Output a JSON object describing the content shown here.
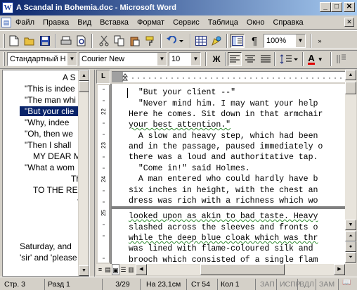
{
  "window": {
    "title": "A Scandal in Bohemia.doc - Microsoft Word",
    "app_icon": "W",
    "minimize": "_",
    "maximize": "□",
    "close": "✕"
  },
  "menu": {
    "items": [
      "Файл",
      "Правка",
      "Вид",
      "Вставка",
      "Формат",
      "Сервис",
      "Таблица",
      "Окно",
      "Справка"
    ]
  },
  "standard_toolbar": {
    "zoom": "100%"
  },
  "format_toolbar": {
    "style": "Стандартный Н",
    "font": "Courier New",
    "size": "10",
    "bold": "Ж",
    "font_color_letter": "A",
    "font_color": "#e00000"
  },
  "document_map": {
    "items": [
      {
        "text": "A S",
        "selected": false
      },
      {
        "text": "\"This is indee",
        "selected": false
      },
      {
        "text": "\"The man whi",
        "selected": false
      },
      {
        "text": "\"But your clie",
        "selected": true
      },
      {
        "text": "\"Why, indee",
        "selected": false
      },
      {
        "text": "\"Oh, then we",
        "selected": false
      },
      {
        "text": "\"Then I shall",
        "selected": false
      },
      {
        "text": "MY DEAR M",
        "selected": false
      },
      {
        "text": "\"What a wom",
        "selected": false
      },
      {
        "text": "Th",
        "selected": false
      },
      {
        "text": "TO THE RE",
        "selected": false
      },
      {
        "text": "Saturday, and",
        "selected": false
      },
      {
        "text": "'sir' and 'please",
        "selected": false
      }
    ]
  },
  "ruler": {
    "corner": "L",
    "vertical_numbers": [
      "22",
      "23",
      "24",
      "25"
    ]
  },
  "document": {
    "page1_lines": [
      "\"But your client --\"",
      "\"Never mind him. I may want your help",
      "Here he comes. Sit down in that armchair",
      "your best attention.\"",
      "A slow and heavy step, which had been",
      "and in the passage, paused immediately o",
      "there was a loud and authoritative tap.",
      "\"Come in!\" said Holmes.",
      "A man entered who could hardly have b",
      "six inches in height, with the chest an",
      "dress was rich with a richness which wo"
    ],
    "page2_lines": [
      "looked upon as akin to bad taste. Heavy",
      "slashed across the sleeves and fronts o",
      "while the deep blue cloak which was thr",
      "was lined with flame-coloured silk and",
      "brooch which consisted of a single flam"
    ]
  },
  "statusbar": {
    "page": "Стр. 3",
    "section": "Разд 1",
    "pages": "3/29",
    "at": "На 23,1см",
    "line": "Ст 54",
    "col": "Кол 1",
    "rec": "ЗАП",
    "trk": "ИСПР",
    "ext": "ВДЛ",
    "ovr": "ЗАМ"
  }
}
